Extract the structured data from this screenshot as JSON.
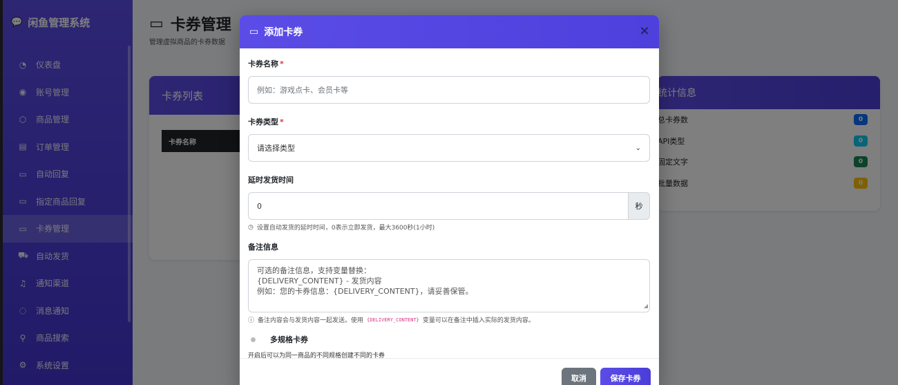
{
  "sidebar": {
    "brand": "闲鱼管理系统",
    "items": [
      {
        "label": "仪表盘",
        "icon": "dashboard-icon"
      },
      {
        "label": "账号管理",
        "icon": "user-circle-icon"
      },
      {
        "label": "商品管理",
        "icon": "box-icon"
      },
      {
        "label": "订单管理",
        "icon": "receipt-icon"
      },
      {
        "label": "自动回复",
        "icon": "chat-square-icon"
      },
      {
        "label": "指定商品回复",
        "icon": "chat-square-icon"
      },
      {
        "label": "卡券管理",
        "icon": "card-icon",
        "active": true
      },
      {
        "label": "自动发货",
        "icon": "truck-icon"
      },
      {
        "label": "通知渠道",
        "icon": "bell-icon"
      },
      {
        "label": "消息通知",
        "icon": "chat-dots-icon"
      },
      {
        "label": "商品搜索",
        "icon": "search-icon"
      },
      {
        "label": "系统设置",
        "icon": "gear-icon"
      }
    ]
  },
  "page": {
    "title": "卡券管理",
    "subtitle": "管理虚拟商品的卡券数据"
  },
  "card_list": {
    "title": "卡券列表",
    "column_name": "卡券名称"
  },
  "stats": {
    "title": "统计信息",
    "rows": [
      {
        "label": "总卡券数",
        "value": "0",
        "color": "#0d6efd"
      },
      {
        "label": "API类型",
        "value": "0",
        "color": "#0dcaf0"
      },
      {
        "label": "固定文字",
        "value": "0",
        "color": "#198754"
      },
      {
        "label": "批量数据",
        "value": "0",
        "color": "#ffc107"
      }
    ]
  },
  "modal": {
    "title": "添加卡券",
    "name_label": "卡券名称",
    "name_placeholder": "例如：游戏点卡、会员卡等",
    "type_label": "卡券类型",
    "type_value": "请选择类型",
    "delay_label": "延时发货时间",
    "delay_value": "0",
    "delay_unit": "秒",
    "delay_help": "设置自动发货的延时时间，0表示立即发货，最大3600秒(1小时)",
    "note_label": "备注信息",
    "note_placeholder_lines": [
      "可选的备注信息，支持变量替换：",
      "{DELIVERY_CONTENT} - 发货内容",
      "例如：您的卡券信息：{DELIVERY_CONTENT}，请妥善保管。"
    ],
    "note_help_prefix": "备注内容会与发货内容一起发送。使用",
    "note_help_code": "{DELIVERY_CONTENT}",
    "note_help_suffix": "变量可以在备注中插入实际的发货内容。",
    "multi_spec_label": "多规格卡券",
    "multi_spec_help": "开启后可以为同一商品的不同规格创建不同的卡券",
    "cancel_label": "取消",
    "save_label": "保存卡券",
    "close_label": "×"
  },
  "colors": {
    "accent": "#5b4ce6",
    "required": "#dc3545"
  }
}
